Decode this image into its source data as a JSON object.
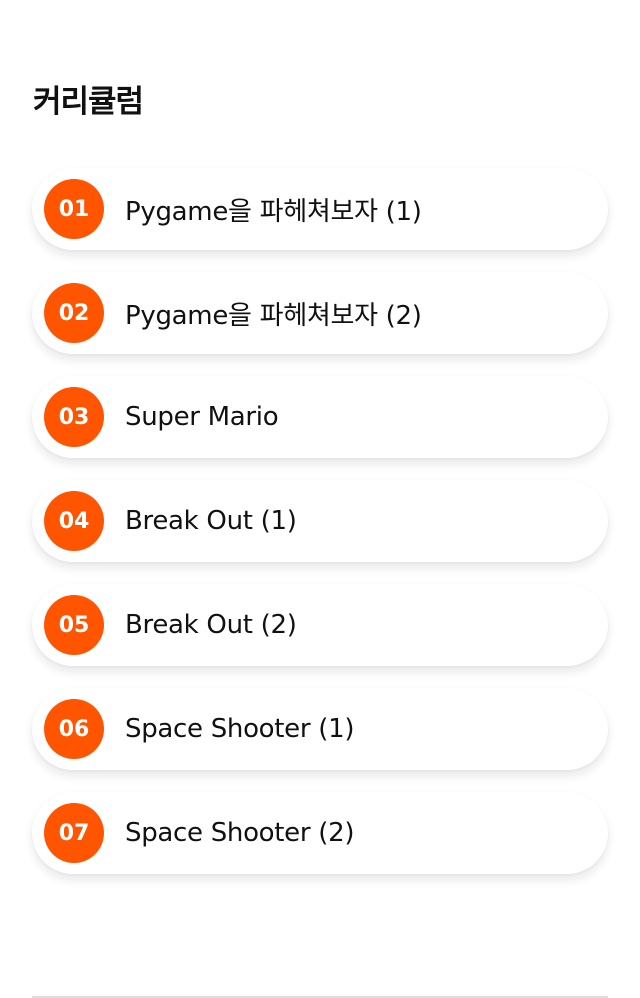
{
  "section_title": "커리큘럼",
  "colors": {
    "accent": "#ff5500",
    "item_background": "#ffffff",
    "divider": "#dddddd"
  },
  "curriculum": [
    {
      "number": "01",
      "title": "Pygame을 파헤쳐보자 (1)"
    },
    {
      "number": "02",
      "title": "Pygame을 파헤쳐보자 (2)"
    },
    {
      "number": "03",
      "title": "Super Mario"
    },
    {
      "number": "04",
      "title": "Break Out (1)"
    },
    {
      "number": "05",
      "title": "Break Out (2)"
    },
    {
      "number": "06",
      "title": "Space Shooter (1)"
    },
    {
      "number": "07",
      "title": "Space Shooter (2)"
    }
  ]
}
